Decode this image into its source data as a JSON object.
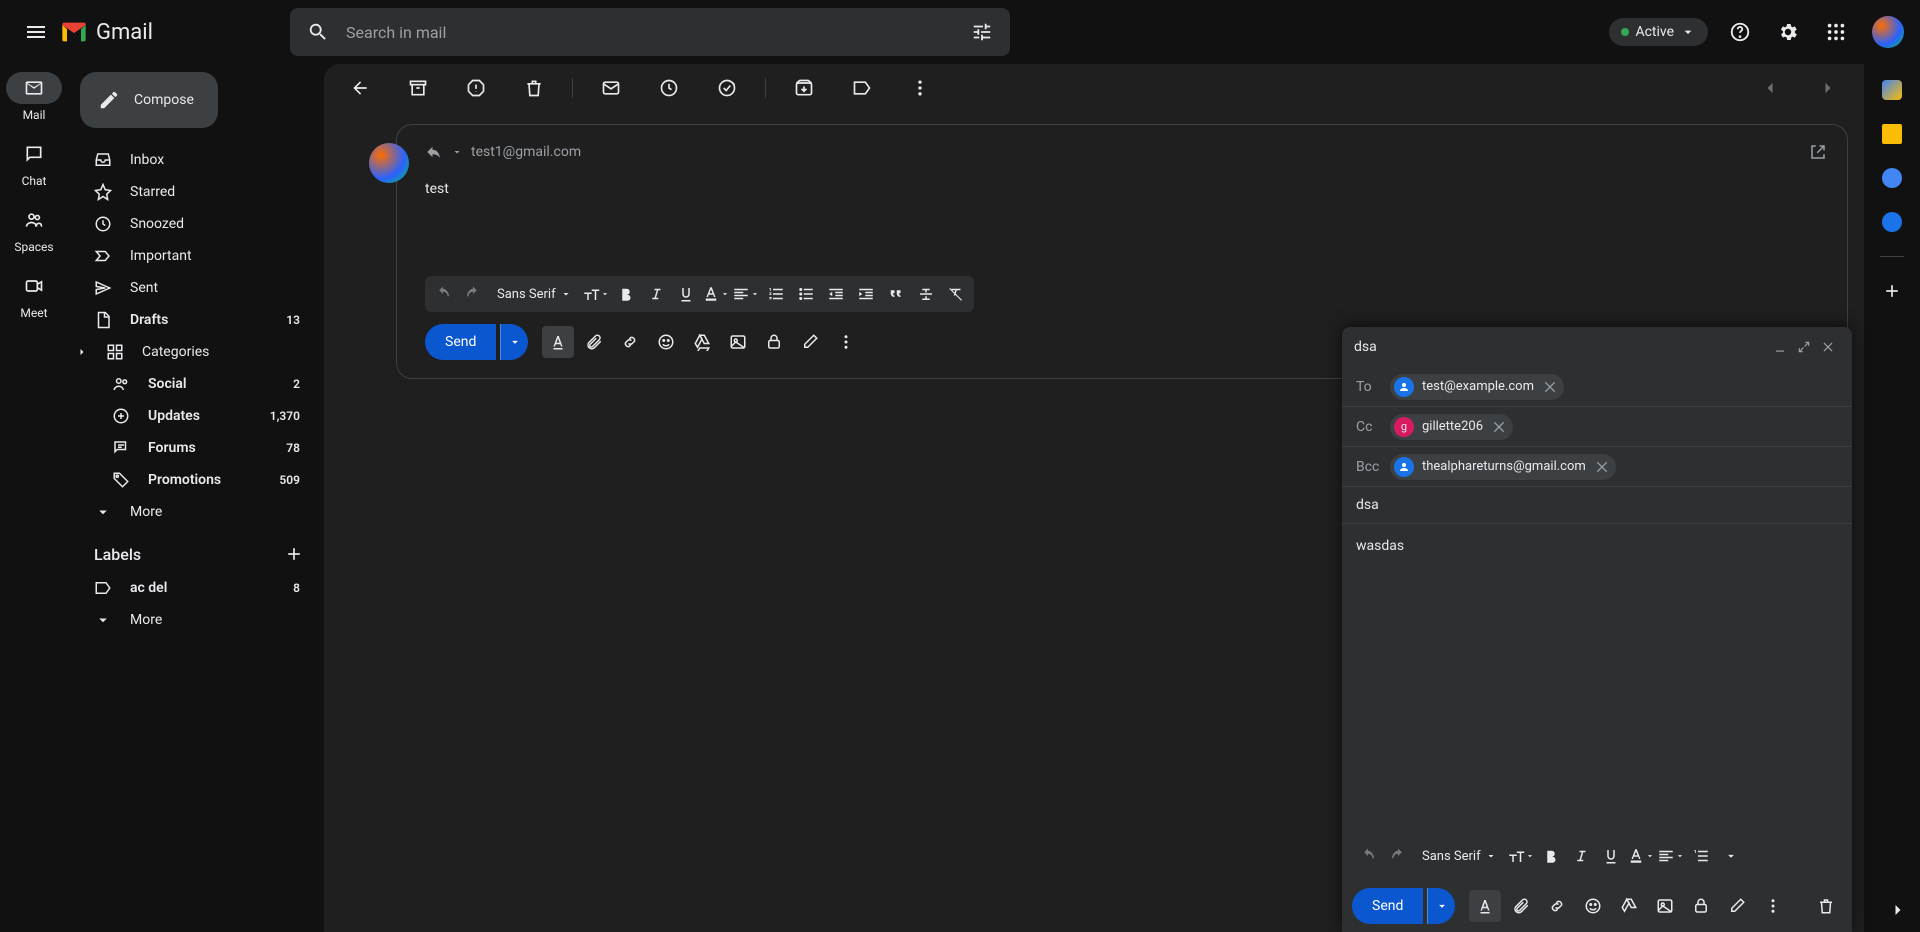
{
  "header": {
    "app_name": "Gmail",
    "search_placeholder": "Search in mail",
    "status_label": "Active"
  },
  "rail": {
    "items": [
      {
        "label": "Mail"
      },
      {
        "label": "Chat"
      },
      {
        "label": "Spaces"
      },
      {
        "label": "Meet"
      }
    ]
  },
  "sidebar": {
    "compose_label": "Compose",
    "items": [
      {
        "label": "Inbox",
        "count": ""
      },
      {
        "label": "Starred",
        "count": ""
      },
      {
        "label": "Snoozed",
        "count": ""
      },
      {
        "label": "Important",
        "count": ""
      },
      {
        "label": "Sent",
        "count": ""
      },
      {
        "label": "Drafts",
        "count": "13",
        "bold": true
      },
      {
        "label": "Categories",
        "count": ""
      },
      {
        "label": "Social",
        "count": "2",
        "bold": true,
        "indent": true
      },
      {
        "label": "Updates",
        "count": "1,370",
        "bold": true,
        "indent": true
      },
      {
        "label": "Forums",
        "count": "78",
        "bold": true,
        "indent": true
      },
      {
        "label": "Promotions",
        "count": "509",
        "bold": true,
        "indent": true
      },
      {
        "label": "More",
        "count": ""
      }
    ],
    "labels_header": "Labels",
    "labels": [
      {
        "label": "ac del",
        "count": "8",
        "bold": true
      }
    ],
    "more_label": "More"
  },
  "reply": {
    "recipient": "test1@gmail.com",
    "body": "test",
    "font": "Sans Serif",
    "send_label": "Send"
  },
  "compose": {
    "title": "dsa",
    "to_label": "To",
    "to_chip": "test@example.com",
    "cc_label": "Cc",
    "cc_chip": "gillette206",
    "cc_initial": "g",
    "bcc_label": "Bcc",
    "bcc_chip": "thealphareturns@gmail.com",
    "subject": "dsa",
    "body": "wasdas",
    "font": "Sans Serif",
    "send_label": "Send"
  },
  "colors": {
    "accent_send": "#0b57d0",
    "status_active": "#34a853"
  }
}
